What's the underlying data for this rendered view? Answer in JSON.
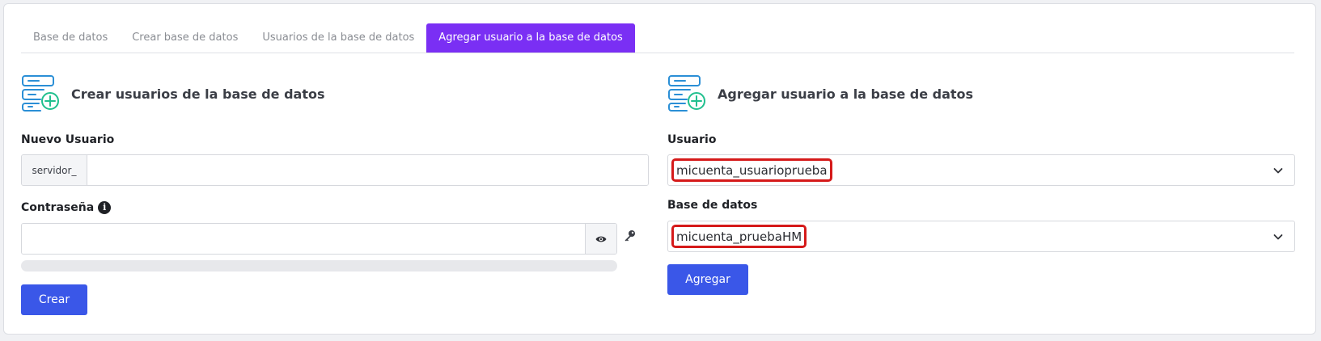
{
  "tabs": [
    {
      "label": "Base de datos",
      "active": false
    },
    {
      "label": "Crear base de datos",
      "active": false
    },
    {
      "label": "Usuarios de la base de datos",
      "active": false
    },
    {
      "label": "Agregar usuario a la base de datos",
      "active": true
    }
  ],
  "create_user": {
    "title": "Crear usuarios de la base de datos",
    "new_user_label": "Nuevo Usuario",
    "prefix": "servidor_",
    "new_user_value": "",
    "password_label": "Contraseña",
    "password_value": "",
    "strength_percent": 0,
    "create_button": "Crear"
  },
  "add_user": {
    "title": "Agregar usuario a la base de datos",
    "user_label": "Usuario",
    "user_value": "micuenta_usuarioprueba",
    "database_label": "Base de datos",
    "database_value": "micuenta_pruebaHM",
    "add_button": "Agregar"
  },
  "colors": {
    "active_tab": "#7a2ff4",
    "primary_button": "#3a57e8",
    "highlight_border": "#d51a1a",
    "icon_blue": "#2b8fd6",
    "icon_green": "#22c08f"
  },
  "icons": [
    "database-add-icon",
    "info-icon",
    "eye-icon",
    "key-icon",
    "chevron-down-icon"
  ]
}
